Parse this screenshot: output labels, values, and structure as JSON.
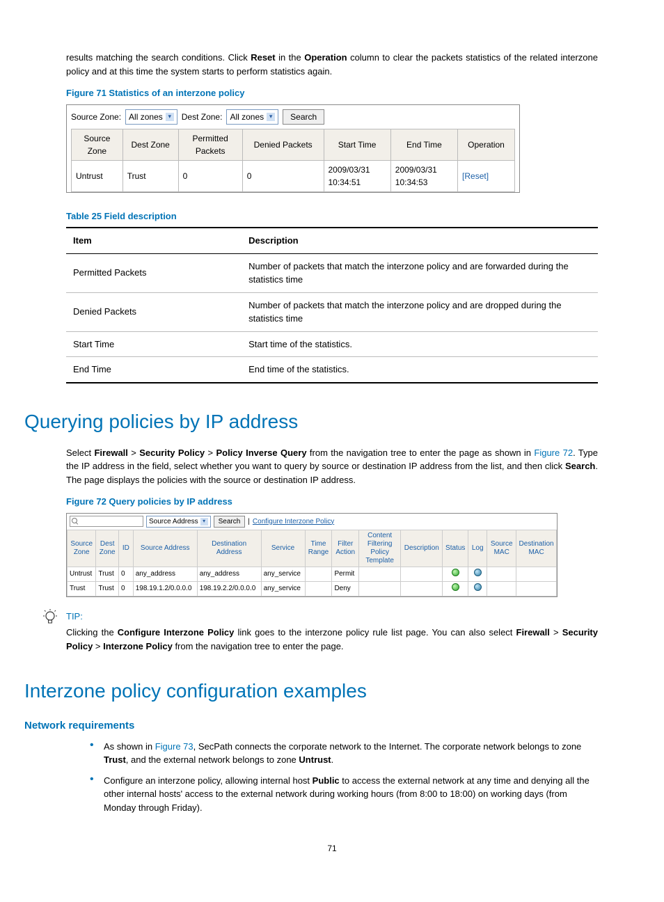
{
  "intro": {
    "p1a": "results matching the search conditions. Click ",
    "p1b": "Reset",
    "p1c": " in the ",
    "p1d": "Operation",
    "p1e": " column to clear the packets statistics of the related interzone policy and at this time the system starts to perform statistics again."
  },
  "fig71": {
    "caption": "Figure 71 Statistics of an interzone policy",
    "src_zone_lbl": "Source Zone:",
    "src_zone_val": "All zones",
    "dst_zone_lbl": "Dest Zone:",
    "dst_zone_val": "All zones",
    "search_btn": "Search",
    "headers": {
      "src": "Source Zone",
      "dst": "Dest Zone",
      "perm": "Permitted Packets",
      "den": "Denied Packets",
      "start": "Start Time",
      "end": "End Time",
      "op": "Operation"
    },
    "row": {
      "src": "Untrust",
      "dst": "Trust",
      "perm": "0",
      "den": "0",
      "start": "2009/03/31 10:34:51",
      "end": "2009/03/31 10:34:53",
      "op": "[Reset]"
    }
  },
  "tbl25": {
    "caption": "Table 25 Field description",
    "head_item": "Item",
    "head_desc": "Description",
    "rows": [
      {
        "item": "Permitted Packets",
        "desc": "Number of packets that match the interzone policy and are forwarded during the statistics time"
      },
      {
        "item": "Denied Packets",
        "desc": "Number of packets that match the interzone policy and are dropped during the statistics time"
      },
      {
        "item": "Start Time",
        "desc": "Start time of the statistics."
      },
      {
        "item": "End Time",
        "desc": "End time of the statistics."
      }
    ]
  },
  "sec_query": {
    "heading": "Querying policies by IP address",
    "p_a": "Select ",
    "p_b": "Firewall",
    "p_c": " > ",
    "p_d": "Security Policy",
    "p_e": " > ",
    "p_f": "Policy Inverse Query",
    "p_g": " from the navigation tree to enter the page as shown in ",
    "p_h": "Figure 72",
    "p_i": ". Type the IP address in the field, select whether you want to query by source or destination IP address from the list, and then click ",
    "p_j": "Search",
    "p_k": ". The page displays the policies with the source or destination IP address."
  },
  "fig72": {
    "caption": "Figure 72 Query policies by IP address",
    "select_val": "Source Address",
    "search_btn": "Search",
    "sep": "|",
    "config_link": "Configure Interzone Policy",
    "headers": {
      "src": "Source Zone",
      "dst": "Dest Zone",
      "id": "ID",
      "saddr": "Source Address",
      "daddr": "Destination Address",
      "svc": "Service",
      "tr": "Time Range",
      "fa": "Filter Action",
      "cfp": "Content Filtering Policy Template",
      "desc": "Description",
      "stat": "Status",
      "log": "Log",
      "smac": "Source MAC",
      "dmac": "Destination MAC"
    },
    "rows": [
      {
        "src": "Untrust",
        "dst": "Trust",
        "id": "0",
        "saddr": "any_address",
        "daddr": "any_address",
        "svc": "any_service",
        "tr": "",
        "fa": "Permit",
        "cfp": "",
        "desc": "",
        "smac": "",
        "dmac": ""
      },
      {
        "src": "Trust",
        "dst": "Trust",
        "id": "0",
        "saddr": "198.19.1.2/0.0.0.0",
        "daddr": "198.19.2.2/0.0.0.0",
        "svc": "any_service",
        "tr": "",
        "fa": "Deny",
        "cfp": "",
        "desc": "",
        "smac": "",
        "dmac": ""
      }
    ]
  },
  "tip": {
    "label": "TIP:",
    "a": "Clicking the ",
    "b": "Configure Interzone Policy",
    "c": " link goes to the interzone policy rule list page. You can also select ",
    "d": "Firewall",
    "e": " > ",
    "f": "Security Policy",
    "g": " > ",
    "h": "Interzone Policy",
    "i": " from the navigation tree to enter the page."
  },
  "sec_examples": {
    "heading": "Interzone policy configuration examples",
    "sub": "Network requirements",
    "b1a": "As shown in ",
    "b1b": "Figure 73",
    "b1c": ", SecPath connects the corporate network to the Internet. The corporate network belongs to zone ",
    "b1d": "Trust",
    "b1e": ", and the external network belongs to zone ",
    "b1f": "Untrust",
    "b1g": ".",
    "b2a": "Configure an interzone policy, allowing internal host ",
    "b2b": "Public",
    "b2c": " to access the external network at any time and denying all the other internal hosts' access to the external network during working hours (from 8:00 to 18:00) on working days (from Monday through Friday)."
  },
  "page_number": "71"
}
